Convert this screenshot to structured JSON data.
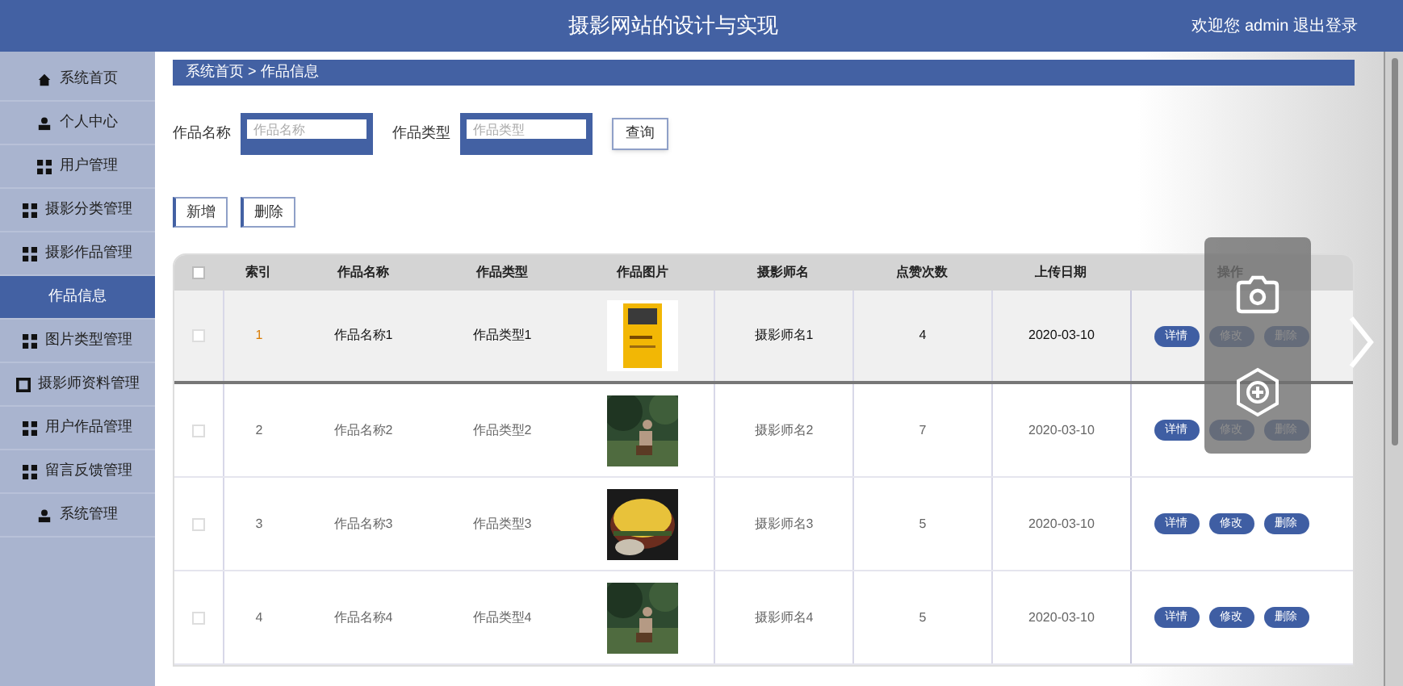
{
  "header": {
    "title": "摄影网站的设计与实现",
    "user": "欢迎您 admin 退出登录"
  },
  "sidebar": {
    "items": [
      {
        "label": "系统首页",
        "kind": "home",
        "selected": false
      },
      {
        "label": "个人中心",
        "kind": "user",
        "selected": false
      },
      {
        "label": "用户管理",
        "kind": "grid",
        "selected": false
      },
      {
        "label": "摄影分类管理",
        "kind": "grid",
        "selected": false
      },
      {
        "label": "摄影作品管理",
        "kind": "grid",
        "selected": false
      },
      {
        "label": "作品信息",
        "kind": "plain",
        "selected": true
      },
      {
        "label": "图片类型管理",
        "kind": "grid",
        "selected": false
      },
      {
        "label": "摄影师资料管理",
        "kind": "square",
        "selected": false
      },
      {
        "label": "用户作品管理",
        "kind": "grid",
        "selected": false
      },
      {
        "label": "留言反馈管理",
        "kind": "grid",
        "selected": false
      },
      {
        "label": "系统管理",
        "kind": "user",
        "selected": false
      }
    ]
  },
  "breadcrumb": "系统首页 > 作品信息",
  "search": {
    "fields": [
      {
        "label": "作品名称",
        "placeholder": "作品名称"
      },
      {
        "label": "作品类型",
        "placeholder": "作品类型"
      }
    ],
    "button": "查询"
  },
  "actions": [
    "新增",
    "删除"
  ],
  "table": {
    "all_checked": false,
    "columns": [
      "索引",
      "作品名称",
      "作品类型",
      "作品图片",
      "摄影师名",
      "点赞次数",
      "上传日期",
      "操作"
    ],
    "rows": [
      {
        "selected": true,
        "checked": false,
        "index": "1",
        "name": "作品名称1",
        "type": "作品类型1",
        "photographer": "摄影师名1",
        "likes": "4",
        "date": "2020-03-10",
        "buttons": [
          "详情",
          "修改",
          "删除"
        ]
      },
      {
        "selected": false,
        "checked": false,
        "index": "2",
        "name": "作品名称2",
        "type": "作品类型2",
        "photographer": "摄影师名2",
        "likes": "7",
        "date": "2020-03-10",
        "buttons": [
          "详情",
          "修改",
          "删除"
        ]
      },
      {
        "selected": false,
        "checked": false,
        "index": "3",
        "name": "作品名称3",
        "type": "作品类型3",
        "photographer": "摄影师名3",
        "likes": "5",
        "date": "2020-03-10",
        "buttons": [
          "详情",
          "修改",
          "删除"
        ]
      },
      {
        "selected": false,
        "checked": false,
        "index": "4",
        "name": "作品名称4",
        "type": "作品类型4",
        "photographer": "摄影师名4",
        "likes": "5",
        "date": "2020-03-10",
        "buttons": [
          "详情",
          "修改",
          "删除"
        ]
      }
    ]
  }
}
